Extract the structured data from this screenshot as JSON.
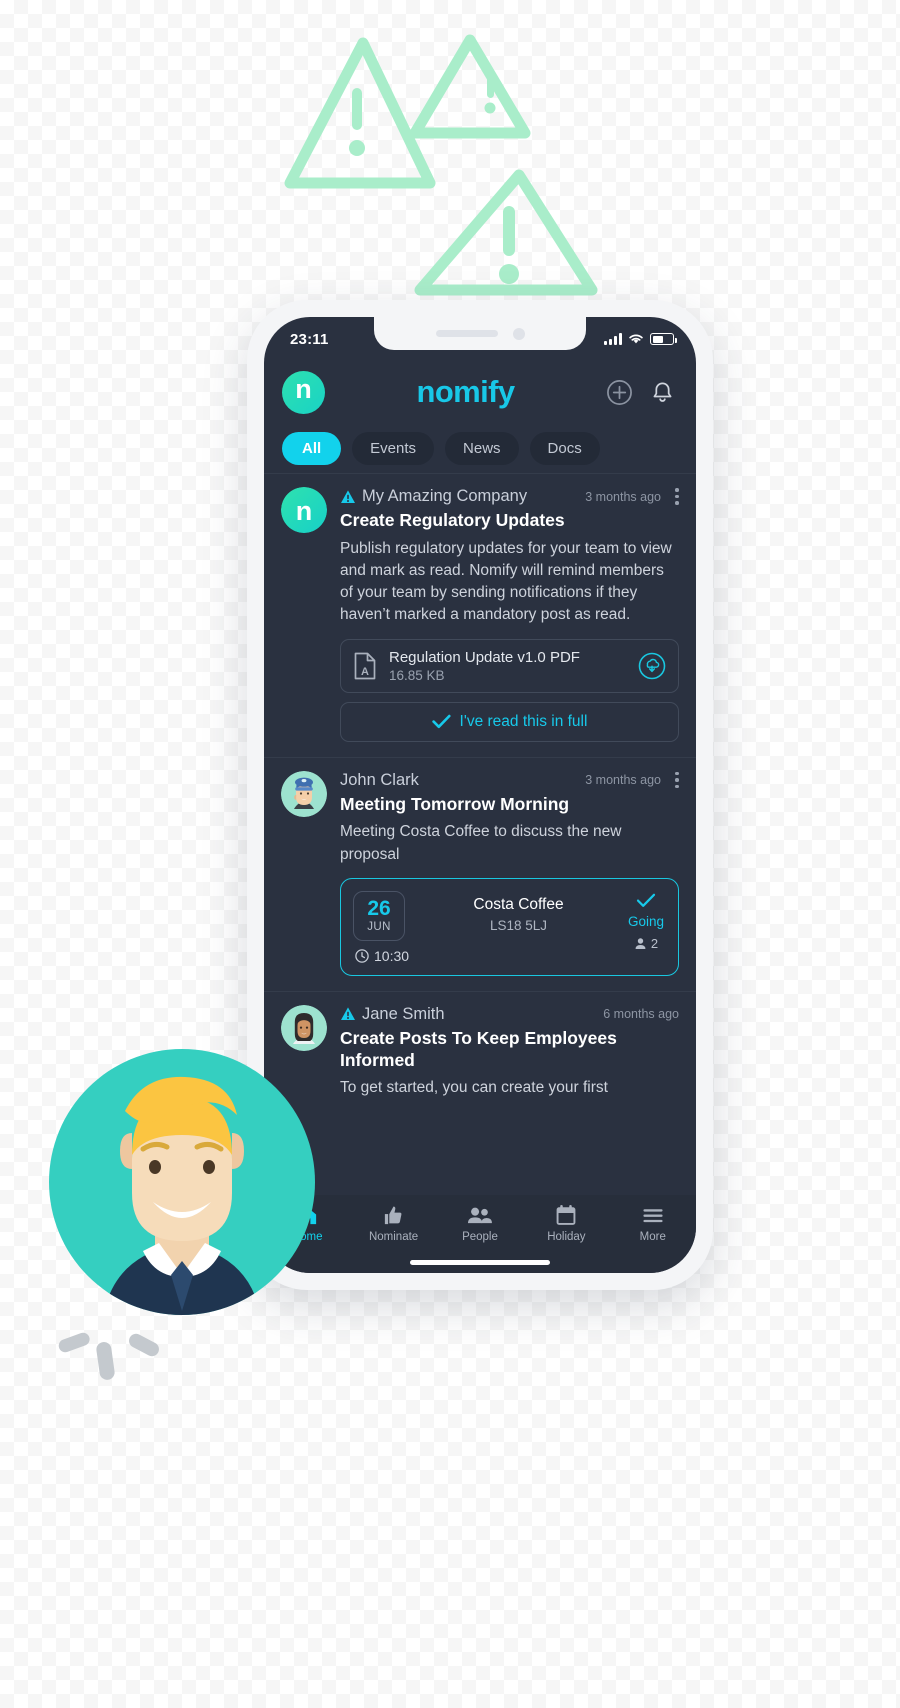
{
  "statusbar": {
    "time": "23:11",
    "signal_icon": "signal-bars-icon",
    "wifi_icon": "wifi-icon",
    "battery_icon": "battery-icon"
  },
  "header": {
    "brand_initial": "n",
    "brand_title": "nomify",
    "add_icon": "plus-circle-icon",
    "bell_icon": "bell-icon"
  },
  "filters": [
    {
      "label": "All",
      "active": true
    },
    {
      "label": "Events",
      "active": false
    },
    {
      "label": "News",
      "active": false
    },
    {
      "label": "Docs",
      "active": false
    }
  ],
  "posts": [
    {
      "author": "My Amazing Company",
      "ago": "3 months ago",
      "mandatory": true,
      "title": "Create Regulatory Updates",
      "text": "Publish regulatory updates for your team to view and mark as read.  Nomify will remind members of your team by sending notifications if they haven’t marked a mandatory post as read.",
      "attachment": {
        "icon": "pdf-file-icon",
        "name": "Regulation Update v1.0 PDF",
        "size": "16.85 KB",
        "download_icon": "download-cloud-icon"
      },
      "read_button": {
        "label": "I've read this in full",
        "icon": "check-icon"
      }
    },
    {
      "author": "John Clark",
      "ago": "3 months ago",
      "mandatory": false,
      "title": "Meeting Tomorrow Morning",
      "text": "Meeting Costa Coffee to discuss the new proposal",
      "event": {
        "day": "26",
        "month": "JUN",
        "time": "10:30",
        "time_icon": "clock-icon",
        "place": "Costa Coffee",
        "address": "LS18 5LJ",
        "rsvp_icon": "check-icon",
        "rsvp_label": "Going",
        "attendee_icon": "person-icon",
        "attendee_count": "2"
      }
    },
    {
      "author": "Jane Smith",
      "ago": "6 months ago",
      "mandatory": true,
      "title": "Create Posts To Keep Employees Informed",
      "text": "To get started, you can create your first"
    }
  ],
  "bottomnav": [
    {
      "label": "Home",
      "icon": "home-icon",
      "active": true
    },
    {
      "label": "Nominate",
      "icon": "thumbs-up-icon",
      "active": false
    },
    {
      "label": "People",
      "icon": "people-icon",
      "active": false
    },
    {
      "label": "Holiday",
      "icon": "calendar-icon",
      "active": false
    },
    {
      "label": "More",
      "icon": "hamburger-icon",
      "active": false
    }
  ],
  "colors": {
    "accent_cyan": "#12d2ec",
    "accent_teal": "#2ee0b0",
    "screen_bg": "#2a3140",
    "nav_bg": "#272e3b",
    "decoration_green": "#a8edc8"
  }
}
